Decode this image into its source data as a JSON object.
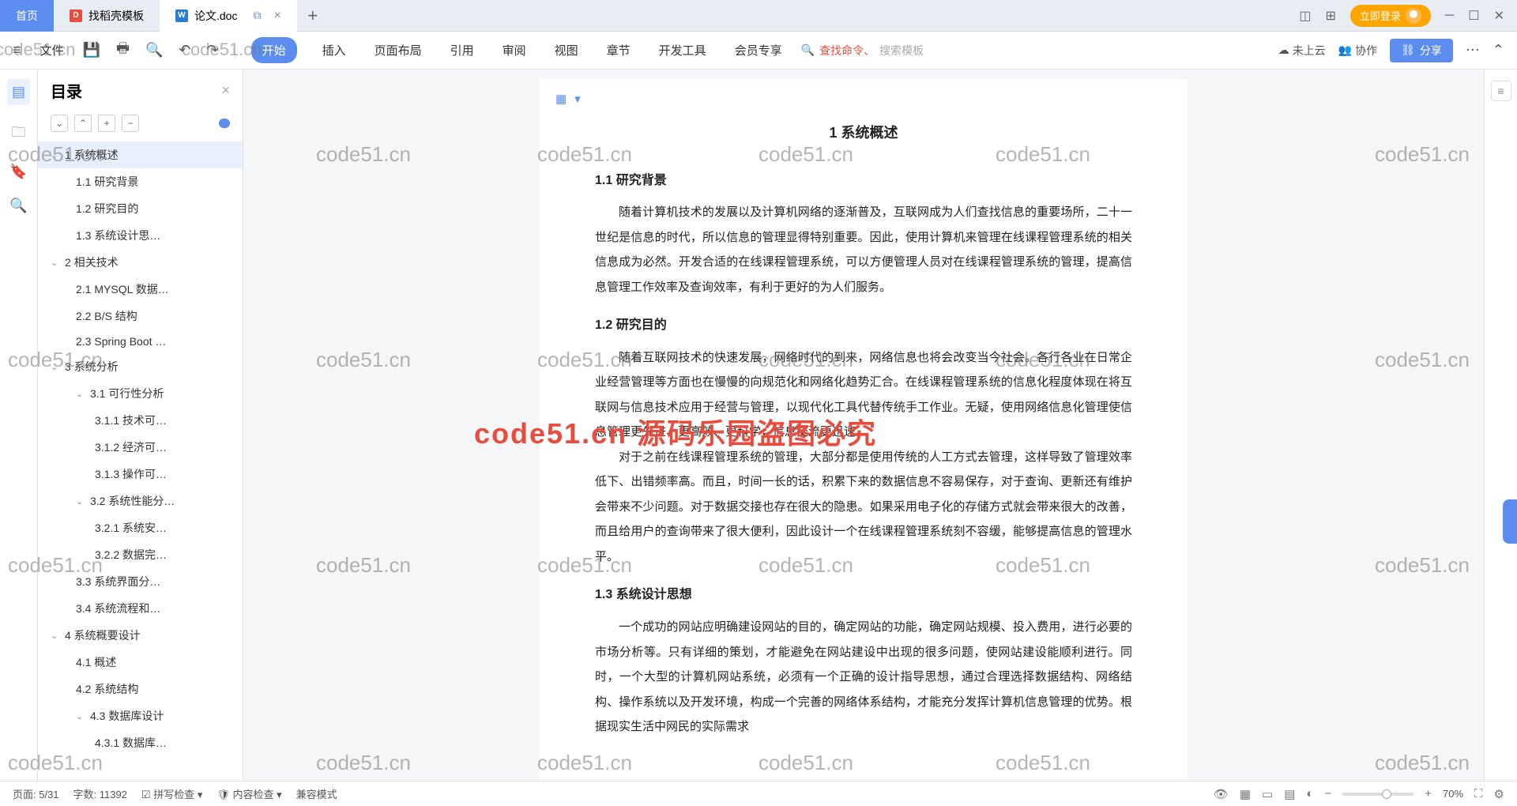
{
  "tabs": {
    "home": "首页",
    "t1": "找稻壳模板",
    "t2": "论文.doc"
  },
  "login": "立即登录",
  "ribbon": {
    "file": "文件",
    "menus": [
      "开始",
      "插入",
      "页面布局",
      "引用",
      "审阅",
      "视图",
      "章节",
      "开发工具",
      "会员专享"
    ],
    "search_red": "查找命令、",
    "search_ph": "搜索模板",
    "cloud": "未上云",
    "coop": "协作",
    "share": "分享"
  },
  "toc": {
    "title": "目录",
    "items": [
      {
        "l": 1,
        "c": true,
        "t": "1 系统概述",
        "sel": true
      },
      {
        "l": 2,
        "t": "1.1 研究背景"
      },
      {
        "l": 2,
        "t": "1.2 研究目的"
      },
      {
        "l": 2,
        "t": "1.3 系统设计思…"
      },
      {
        "l": 1,
        "c": true,
        "t": "2 相关技术"
      },
      {
        "l": 2,
        "t": "2.1 MYSQL 数据…"
      },
      {
        "l": 2,
        "t": "2.2 B/S 结构"
      },
      {
        "l": 2,
        "t": "2.3 Spring Boot …"
      },
      {
        "l": 1,
        "c": true,
        "t": "3 系统分析"
      },
      {
        "l": 2,
        "c": true,
        "t": "3.1 可行性分析"
      },
      {
        "l": 3,
        "t": "3.1.1 技术可…"
      },
      {
        "l": 3,
        "t": "3.1.2 经济可…"
      },
      {
        "l": 3,
        "t": "3.1.3 操作可…"
      },
      {
        "l": 2,
        "c": true,
        "t": "3.2 系统性能分…"
      },
      {
        "l": 3,
        "t": "3.2.1 系统安…"
      },
      {
        "l": 3,
        "t": "3.2.2 数据完…"
      },
      {
        "l": 2,
        "t": "3.3 系统界面分…"
      },
      {
        "l": 2,
        "t": "3.4 系统流程和…"
      },
      {
        "l": 1,
        "c": true,
        "t": "4 系统概要设计"
      },
      {
        "l": 2,
        "t": "4.1 概述"
      },
      {
        "l": 2,
        "t": "4.2 系统结构"
      },
      {
        "l": 2,
        "c": true,
        "t": "4.3 数据库设计"
      },
      {
        "l": 3,
        "t": "4.3.1 数据库…"
      }
    ]
  },
  "doc": {
    "h1": "1 系统概述",
    "s11": "1.1 研究背景",
    "p11": "随着计算机技术的发展以及计算机网络的逐渐普及，互联网成为人们查找信息的重要场所，二十一世纪是信息的时代，所以信息的管理显得特别重要。因此，使用计算机来管理在线课程管理系统的相关信息成为必然。开发合适的在线课程管理系统，可以方便管理人员对在线课程管理系统的管理，提高信息管理工作效率及查询效率，有利于更好的为人们服务。",
    "s12": "1.2 研究目的",
    "p12a": "随着互联网技术的快速发展，网络时代的到来，网络信息也将会改变当今社会。各行各业在日常企业经营管理等方面也在慢慢的向规范化和网络化趋势汇合。在线课程管理系统的信息化程度体现在将互联网与信息技术应用于经营与管理，以现代化工具代替传统手工作业。无疑，使用网络信息化管理使信息管理更先进、更高效、更科学，信息交流更迅速。",
    "p12b": "对于之前在线课程管理系统的管理，大部分都是使用传统的人工方式去管理，这样导致了管理效率低下、出错频率高。而且，时间一长的话，积累下来的数据信息不容易保存，对于查询、更新还有维护会带来不少问题。对于数据交接也存在很大的隐患。如果采用电子化的存储方式就会带来很大的改善，而且给用户的查询带来了很大便利，因此设计一个在线课程管理系统刻不容缓，能够提高信息的管理水平。",
    "s13": "1.3 系统设计思想",
    "p13": "一个成功的网站应明确建设网站的目的，确定网站的功能，确定网站规模、投入费用，进行必要的市场分析等。只有详细的策划，才能避免在网站建设中出现的很多问题，使网站建设能顺利进行。同时，一个大型的计算机网站系统，必须有一个正确的设计指导思想，通过合理选择数据结构、网络结构、操作系统以及开发环境，构成一个完善的网络体系结构，才能充分发挥计算机信息管理的优势。根据现实生活中网民的实际需求"
  },
  "status": {
    "page": "页面: 5/31",
    "words": "字数: 11392",
    "spell": "拼写检查",
    "content": "内容检查",
    "compat": "兼容模式",
    "zoom": "70%"
  },
  "wm": "code51.cn",
  "wm_red": "code51.cn 源码乐园盗图必究"
}
